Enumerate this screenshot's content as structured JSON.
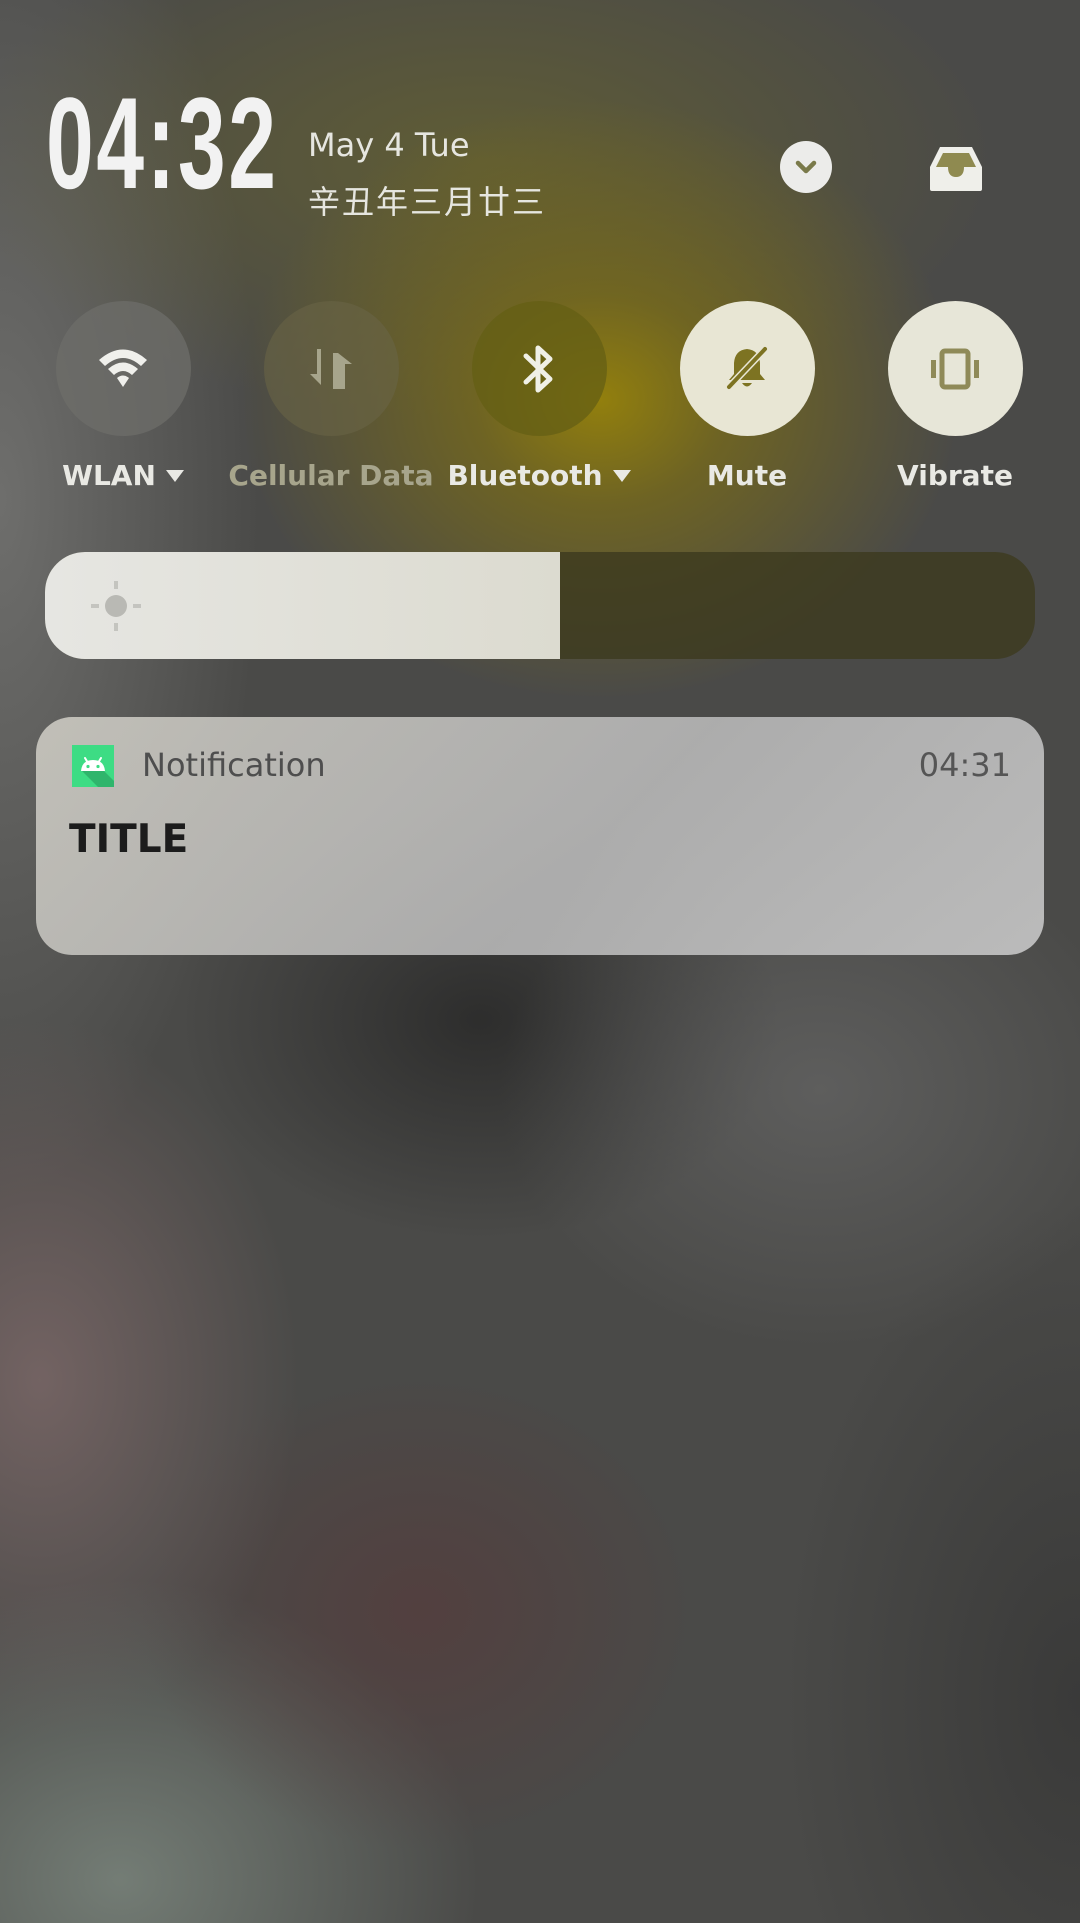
{
  "header": {
    "time": "04:32",
    "date": "May 4 Tue",
    "lunar_date": "辛丑年三月廿三",
    "collapse_icon": "chevron-down-icon",
    "inbox_icon": "inbox-tray-icon"
  },
  "toggles": [
    {
      "label": "WLAN",
      "icon": "wifi-icon",
      "state": "off",
      "has_dropdown": true
    },
    {
      "label": "Cellular Data",
      "icon": "cellular-data-icon",
      "state": "disabled",
      "has_dropdown": false
    },
    {
      "label": "Bluetooth",
      "icon": "bluetooth-icon",
      "state": "off",
      "has_dropdown": true
    },
    {
      "label": "Mute",
      "icon": "bell-muted-icon",
      "state": "on",
      "has_dropdown": false
    },
    {
      "label": "Vibrate",
      "icon": "vibrate-icon",
      "state": "on",
      "has_dropdown": false
    }
  ],
  "brightness": {
    "level_percent": 52,
    "icon": "brightness-sun-icon"
  },
  "notification": {
    "app_icon": "android-icon",
    "app_name": "Notification",
    "time": "04:31",
    "title": "TITLE"
  },
  "colors": {
    "accent_yellow": "#8a7a0c",
    "toggle_active": "#e8e6d4",
    "android_green": "#3ddc84"
  }
}
